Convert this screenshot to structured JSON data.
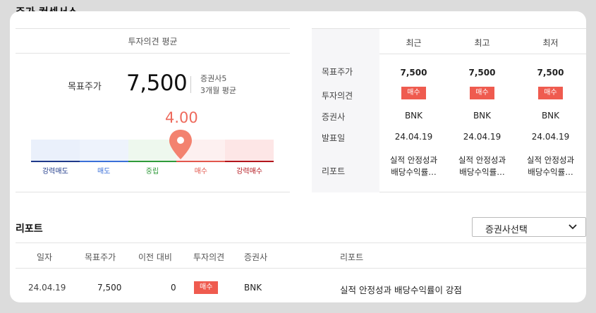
{
  "section": {
    "title": "주가 컨센서스"
  },
  "consensus": {
    "header": "투자의견 평균",
    "target_label": "목표주가",
    "target_value": "7,500",
    "brokers_count": "증권사5",
    "period": "3개월 평균",
    "score": "4.00",
    "score_fraction": 0.615,
    "scale": [
      {
        "label": "강력매도",
        "color": "#1f3a8a",
        "bg": "#eaf0fb"
      },
      {
        "label": "매도",
        "color": "#3a6fd8",
        "bg": "#eef3fc"
      },
      {
        "label": "중립",
        "color": "#2f9a3a",
        "bg": "#eef8ee"
      },
      {
        "label": "매수",
        "color": "#e2574c",
        "bg": "#fdf0f0"
      },
      {
        "label": "강력매수",
        "color": "#b3151c",
        "bg": "#fde6e6"
      }
    ],
    "colors": {
      "accent": "#ee6a5c",
      "badge": "#ef5b4f"
    }
  },
  "summary_table": {
    "columns": [
      "최근",
      "최고",
      "최저"
    ],
    "row_labels": [
      "목표주가",
      "투자의견",
      "증권사",
      "발표일",
      "리포트"
    ],
    "cells": [
      {
        "target": "7,500",
        "opinion": "매수",
        "broker": "BNK",
        "date": "24.04.19",
        "report_l1": "실적 안정성과",
        "report_l2": "배당수익률…"
      },
      {
        "target": "7,500",
        "opinion": "매수",
        "broker": "BNK",
        "date": "24.04.19",
        "report_l1": "실적 안정성과",
        "report_l2": "배당수익률…"
      },
      {
        "target": "7,500",
        "opinion": "매수",
        "broker": "BNK",
        "date": "24.04.19",
        "report_l1": "실적 안정성과",
        "report_l2": "배당수익률…"
      }
    ]
  },
  "reports": {
    "title": "리포트",
    "broker_select": "증권사선택",
    "headers": [
      "일자",
      "목표주가",
      "이전 대비",
      "투자의견",
      "증권사",
      "리포트"
    ],
    "rows": [
      {
        "date": "24.04.19",
        "target": "7,500",
        "change": "0",
        "opinion": "매수",
        "broker": "BNK",
        "report": "실적 안정성과 배당수익률이 강점"
      }
    ]
  }
}
